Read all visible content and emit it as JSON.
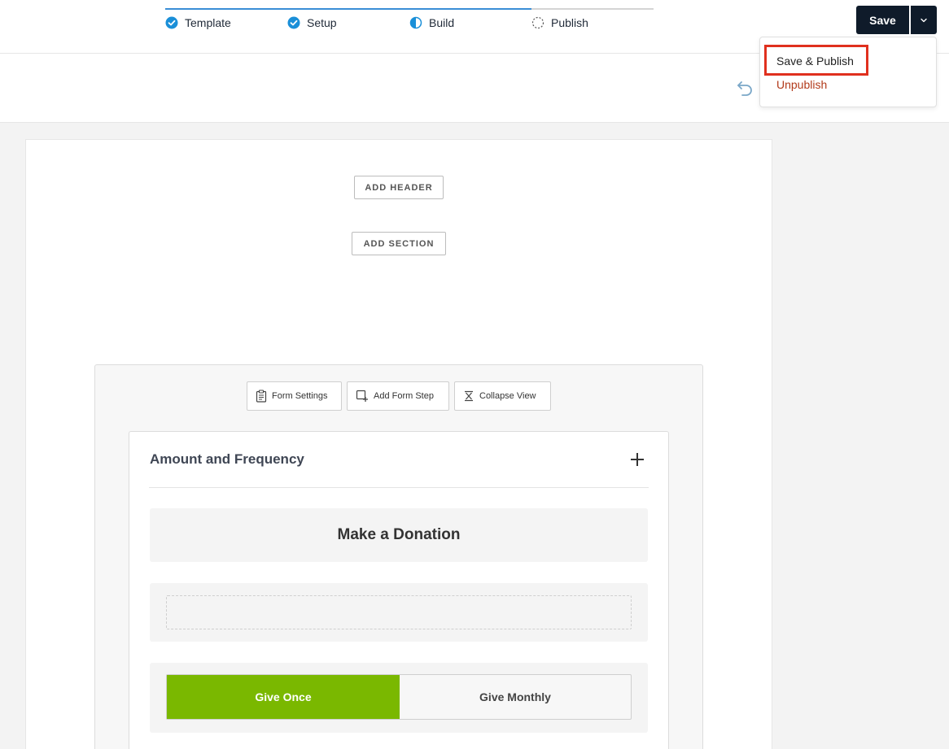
{
  "steps": [
    {
      "label": "Template",
      "status": "complete",
      "icon": "check-circle-icon"
    },
    {
      "label": "Setup",
      "status": "complete",
      "icon": "check-circle-icon"
    },
    {
      "label": "Build",
      "status": "in-progress",
      "icon": "half-circle-icon"
    },
    {
      "label": "Publish",
      "status": "pending",
      "icon": "dashed-circle-icon"
    }
  ],
  "toolbar": {
    "save_label": "Save",
    "caret_icon": "chevron-down-icon",
    "undo_icon": "undo-icon"
  },
  "dropdown": {
    "items": [
      {
        "label": "Save & Publish"
      },
      {
        "label": "Unpublish"
      }
    ]
  },
  "canvas": {
    "add_header": "ADD HEADER",
    "add_section": "ADD SECTION"
  },
  "form_tools": [
    {
      "label": "Form Settings",
      "icon": "clipboard-icon"
    },
    {
      "label": "Add Form Step",
      "icon": "add-step-icon"
    },
    {
      "label": "Collapse View",
      "icon": "collapse-icon"
    }
  ],
  "form_step": {
    "title": "Amount and Frequency",
    "donation_heading": "Make a Donation",
    "frequency_options": [
      "Give Once",
      "Give Monthly"
    ],
    "selected": "Give Once"
  },
  "colors": {
    "primary_dark": "#0f1b2a",
    "accent_blue": "#3a8ed6",
    "give_green": "#7ab800",
    "unpublish_red": "#b23a1a",
    "highlight_red": "#e0301e"
  }
}
